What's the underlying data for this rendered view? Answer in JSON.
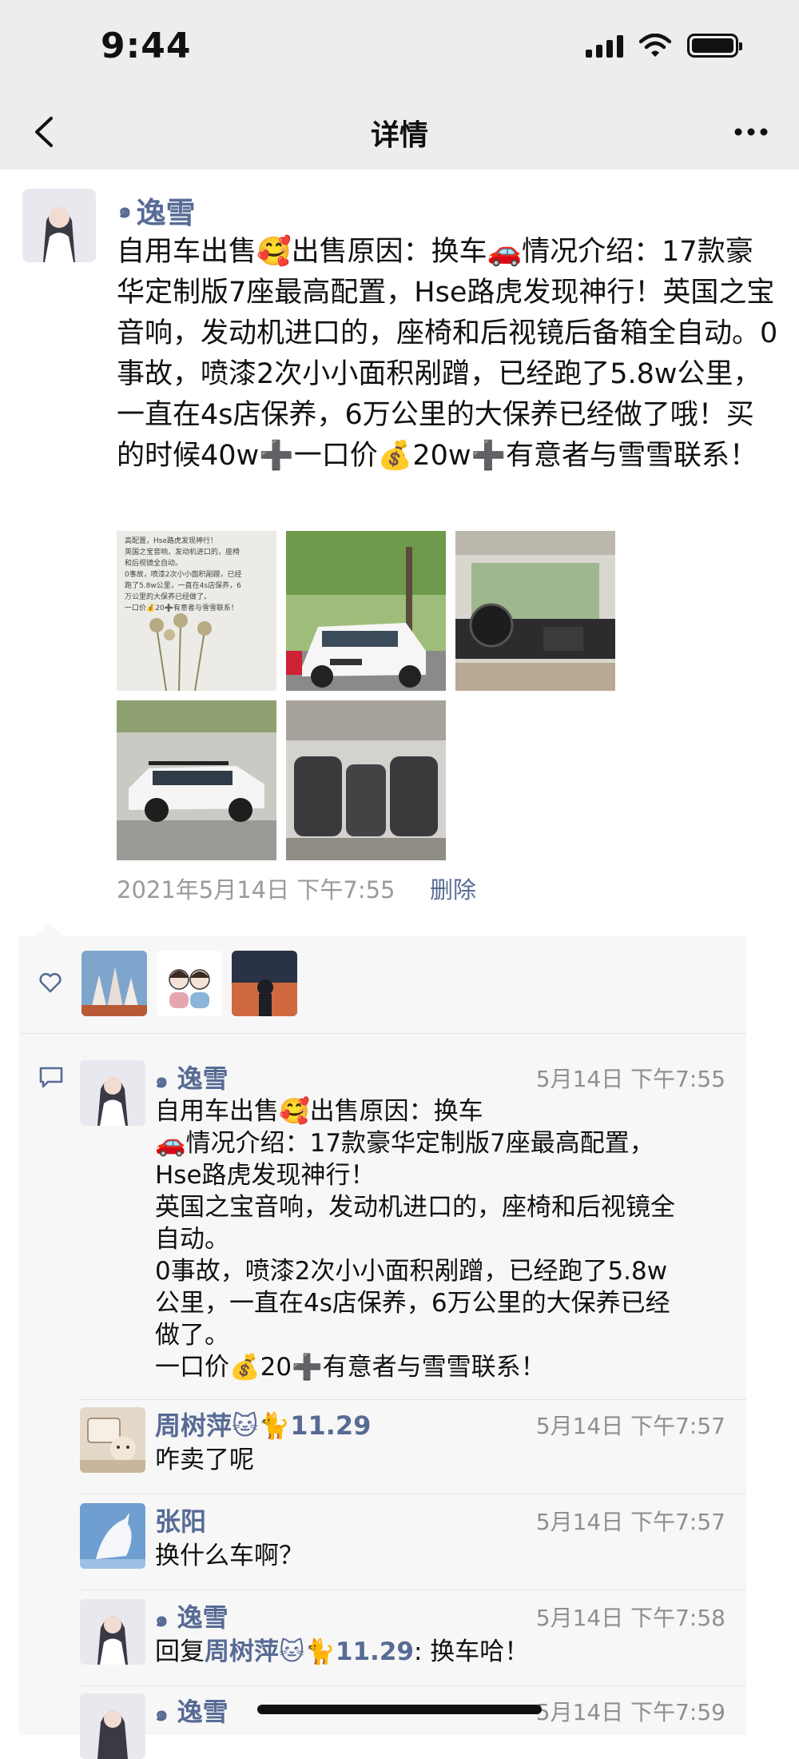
{
  "status_bar": {
    "time": "9:44"
  },
  "nav": {
    "title": "详情"
  },
  "post": {
    "author": "逸雪",
    "text": "自用车出售🥰出售原因：换车🚗情况介绍：17款豪华定制版7座最高配置，Hse路虎发现神行！英国之宝音响，发动机进口的，座椅和后视镜后备箱全自动。0事故，喷漆2次小小面积剐蹭，已经跑了5.8w公里，一直在4s店保养，6万公里的大保养已经做了哦！买的时候40w➕一口价💰20w➕有意者与雪雪联系！",
    "time": "2021年5月14日 下午7:55",
    "delete_label": "删除",
    "image_note_lines": [
      "高配置，Hse路虎发现神行！",
      "英国之宝音响，发动机进口的，座椅",
      "和后视镜全自动。",
      "0事故，喷漆2次小小面积剐蹭，已经",
      "跑了5.8w公里，一直在4s店保养，6",
      "万公里的大保养已经做了。",
      "一口价💰20➕有意者与雪雪联系！"
    ]
  },
  "comments": [
    {
      "name": "逸雪",
      "time": "5月14日 下午7:55",
      "text": "自用车出售🥰出售原因：换车\n🚗情况介绍：17款豪华定制版7座最高配置，\nHse路虎发现神行！\n英国之宝音响，发动机进口的，座椅和后视镜全\n自动。\n0事故，喷漆2次小小面积剐蹭，已经跑了5.8w\n公里，一直在4s店保养，6万公里的大保养已经\n做了。\n一口价💰20➕有意者与雪雪联系！"
    },
    {
      "name": "周树萍🐱🐈11.29",
      "time": "5月14日 下午7:57",
      "text": "咋卖了呢"
    },
    {
      "name": "张阳",
      "time": "5月14日 下午7:57",
      "text": "换什么车啊？"
    },
    {
      "name": "逸雪",
      "time": "5月14日 下午7:58",
      "reply_prefix": "回复",
      "reply_to": "周树萍🐱🐈11.29",
      "text": ": 换车哈！"
    },
    {
      "name": "逸雪",
      "time": "5月14日 下午7:59"
    }
  ],
  "colors": {
    "link": "#576b95",
    "panel": "#f7f7f7",
    "nav_bg": "#ededed"
  }
}
